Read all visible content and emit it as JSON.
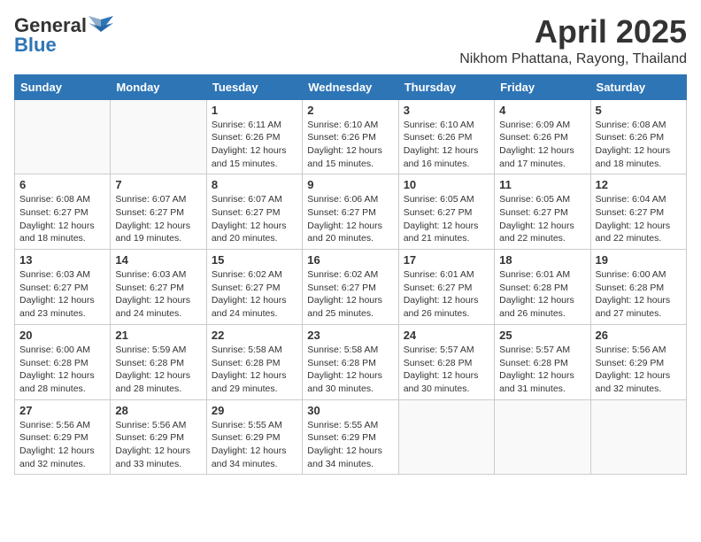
{
  "header": {
    "logo_general": "General",
    "logo_blue": "Blue",
    "month_year": "April 2025",
    "location": "Nikhom Phattana, Rayong, Thailand"
  },
  "weekdays": [
    "Sunday",
    "Monday",
    "Tuesday",
    "Wednesday",
    "Thursday",
    "Friday",
    "Saturday"
  ],
  "weeks": [
    [
      {
        "day": "",
        "info": ""
      },
      {
        "day": "",
        "info": ""
      },
      {
        "day": "1",
        "info": "Sunrise: 6:11 AM\nSunset: 6:26 PM\nDaylight: 12 hours and 15 minutes."
      },
      {
        "day": "2",
        "info": "Sunrise: 6:10 AM\nSunset: 6:26 PM\nDaylight: 12 hours and 15 minutes."
      },
      {
        "day": "3",
        "info": "Sunrise: 6:10 AM\nSunset: 6:26 PM\nDaylight: 12 hours and 16 minutes."
      },
      {
        "day": "4",
        "info": "Sunrise: 6:09 AM\nSunset: 6:26 PM\nDaylight: 12 hours and 17 minutes."
      },
      {
        "day": "5",
        "info": "Sunrise: 6:08 AM\nSunset: 6:26 PM\nDaylight: 12 hours and 18 minutes."
      }
    ],
    [
      {
        "day": "6",
        "info": "Sunrise: 6:08 AM\nSunset: 6:27 PM\nDaylight: 12 hours and 18 minutes."
      },
      {
        "day": "7",
        "info": "Sunrise: 6:07 AM\nSunset: 6:27 PM\nDaylight: 12 hours and 19 minutes."
      },
      {
        "day": "8",
        "info": "Sunrise: 6:07 AM\nSunset: 6:27 PM\nDaylight: 12 hours and 20 minutes."
      },
      {
        "day": "9",
        "info": "Sunrise: 6:06 AM\nSunset: 6:27 PM\nDaylight: 12 hours and 20 minutes."
      },
      {
        "day": "10",
        "info": "Sunrise: 6:05 AM\nSunset: 6:27 PM\nDaylight: 12 hours and 21 minutes."
      },
      {
        "day": "11",
        "info": "Sunrise: 6:05 AM\nSunset: 6:27 PM\nDaylight: 12 hours and 22 minutes."
      },
      {
        "day": "12",
        "info": "Sunrise: 6:04 AM\nSunset: 6:27 PM\nDaylight: 12 hours and 22 minutes."
      }
    ],
    [
      {
        "day": "13",
        "info": "Sunrise: 6:03 AM\nSunset: 6:27 PM\nDaylight: 12 hours and 23 minutes."
      },
      {
        "day": "14",
        "info": "Sunrise: 6:03 AM\nSunset: 6:27 PM\nDaylight: 12 hours and 24 minutes."
      },
      {
        "day": "15",
        "info": "Sunrise: 6:02 AM\nSunset: 6:27 PM\nDaylight: 12 hours and 24 minutes."
      },
      {
        "day": "16",
        "info": "Sunrise: 6:02 AM\nSunset: 6:27 PM\nDaylight: 12 hours and 25 minutes."
      },
      {
        "day": "17",
        "info": "Sunrise: 6:01 AM\nSunset: 6:27 PM\nDaylight: 12 hours and 26 minutes."
      },
      {
        "day": "18",
        "info": "Sunrise: 6:01 AM\nSunset: 6:28 PM\nDaylight: 12 hours and 26 minutes."
      },
      {
        "day": "19",
        "info": "Sunrise: 6:00 AM\nSunset: 6:28 PM\nDaylight: 12 hours and 27 minutes."
      }
    ],
    [
      {
        "day": "20",
        "info": "Sunrise: 6:00 AM\nSunset: 6:28 PM\nDaylight: 12 hours and 28 minutes."
      },
      {
        "day": "21",
        "info": "Sunrise: 5:59 AM\nSunset: 6:28 PM\nDaylight: 12 hours and 28 minutes."
      },
      {
        "day": "22",
        "info": "Sunrise: 5:58 AM\nSunset: 6:28 PM\nDaylight: 12 hours and 29 minutes."
      },
      {
        "day": "23",
        "info": "Sunrise: 5:58 AM\nSunset: 6:28 PM\nDaylight: 12 hours and 30 minutes."
      },
      {
        "day": "24",
        "info": "Sunrise: 5:57 AM\nSunset: 6:28 PM\nDaylight: 12 hours and 30 minutes."
      },
      {
        "day": "25",
        "info": "Sunrise: 5:57 AM\nSunset: 6:28 PM\nDaylight: 12 hours and 31 minutes."
      },
      {
        "day": "26",
        "info": "Sunrise: 5:56 AM\nSunset: 6:29 PM\nDaylight: 12 hours and 32 minutes."
      }
    ],
    [
      {
        "day": "27",
        "info": "Sunrise: 5:56 AM\nSunset: 6:29 PM\nDaylight: 12 hours and 32 minutes."
      },
      {
        "day": "28",
        "info": "Sunrise: 5:56 AM\nSunset: 6:29 PM\nDaylight: 12 hours and 33 minutes."
      },
      {
        "day": "29",
        "info": "Sunrise: 5:55 AM\nSunset: 6:29 PM\nDaylight: 12 hours and 34 minutes."
      },
      {
        "day": "30",
        "info": "Sunrise: 5:55 AM\nSunset: 6:29 PM\nDaylight: 12 hours and 34 minutes."
      },
      {
        "day": "",
        "info": ""
      },
      {
        "day": "",
        "info": ""
      },
      {
        "day": "",
        "info": ""
      }
    ]
  ]
}
